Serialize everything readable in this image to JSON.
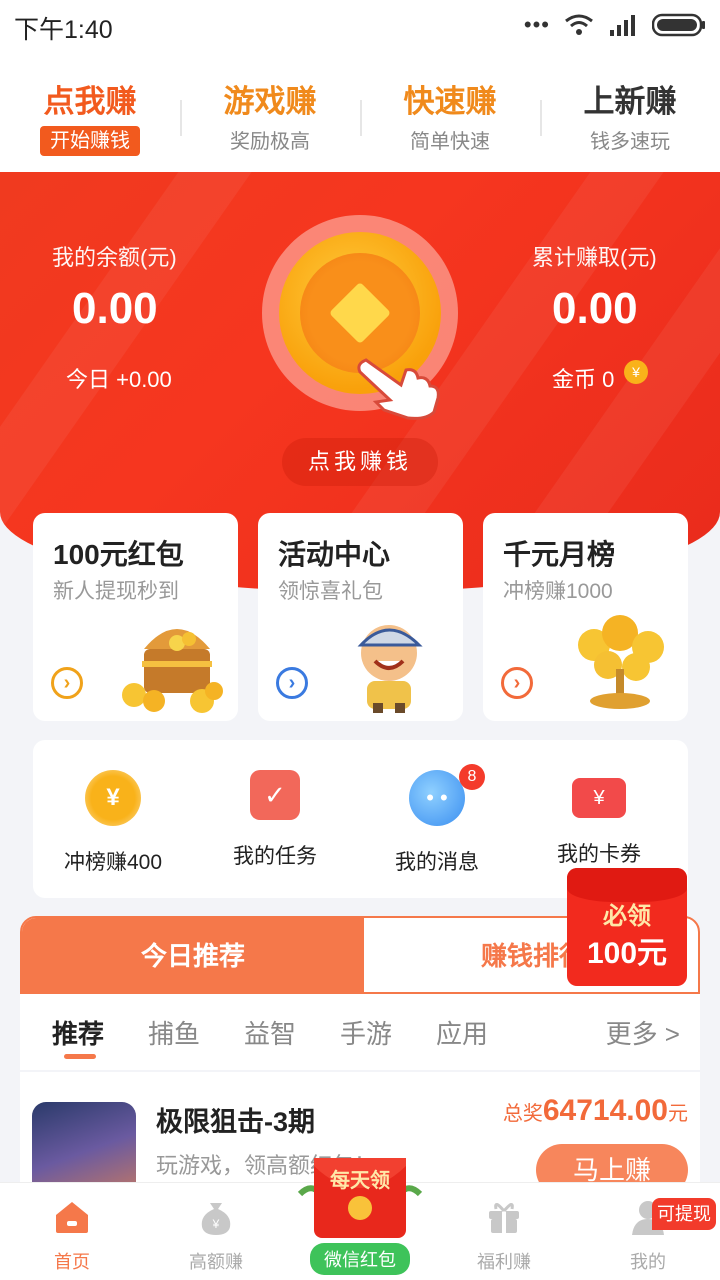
{
  "status": {
    "time": "下午1:40"
  },
  "topnav": [
    {
      "title": "点我赚",
      "sub": "开始赚钱",
      "color": "#f25a1e"
    },
    {
      "title": "游戏赚",
      "sub": "奖励极高",
      "color": "#f08a1c"
    },
    {
      "title": "快速赚",
      "sub": "简单快速",
      "color": "#f08a1c"
    },
    {
      "title": "上新赚",
      "sub": "钱多速玩",
      "color": "#333333"
    }
  ],
  "hero": {
    "balance_label": "我的余额(元)",
    "balance_value": "0.00",
    "today": "今日 +0.00",
    "total_label": "累计赚取(元)",
    "total_value": "0.00",
    "coins": "金币 0",
    "earn_button": "点我赚钱"
  },
  "cards": [
    {
      "title": "100元红包",
      "sub": "新人提现秒到",
      "arrow_color": "#f0a21a"
    },
    {
      "title": "活动中心",
      "sub": "领惊喜礼包",
      "arrow_color": "#3a7ae0"
    },
    {
      "title": "千元月榜",
      "sub": "冲榜赚1000",
      "arrow_color": "#f26a3a"
    }
  ],
  "quick": [
    {
      "label": "冲榜赚400"
    },
    {
      "label": "我的任务"
    },
    {
      "label": "我的消息",
      "badge": "8"
    },
    {
      "label": "我的卡券"
    }
  ],
  "float_packet": {
    "line1": "必领",
    "line2": "100元"
  },
  "rec_tabs": {
    "today": "今日推荐",
    "rank": "赚钱排行"
  },
  "categories": [
    "推荐",
    "捕鱼",
    "益智",
    "手游",
    "应用"
  ],
  "more": "更多 >",
  "game": {
    "title": "极限狙击-3期",
    "desc": "玩游戏，领高额红包！",
    "prize_prefix": "总奖",
    "prize_amount": "64714.00",
    "prize_unit": "元",
    "button": "马上赚"
  },
  "tabbar": [
    {
      "label": "首页"
    },
    {
      "label": "高额赚"
    },
    {
      "label": "微信红包"
    },
    {
      "label": "福利赚"
    },
    {
      "label": "我的"
    }
  ],
  "daily_packet": "每天领",
  "withdraw_badge": "可提现",
  "colors": {
    "brand": "#f5784a",
    "hero_red": "#f03a1f",
    "coin_gold": "#f9a10b"
  }
}
